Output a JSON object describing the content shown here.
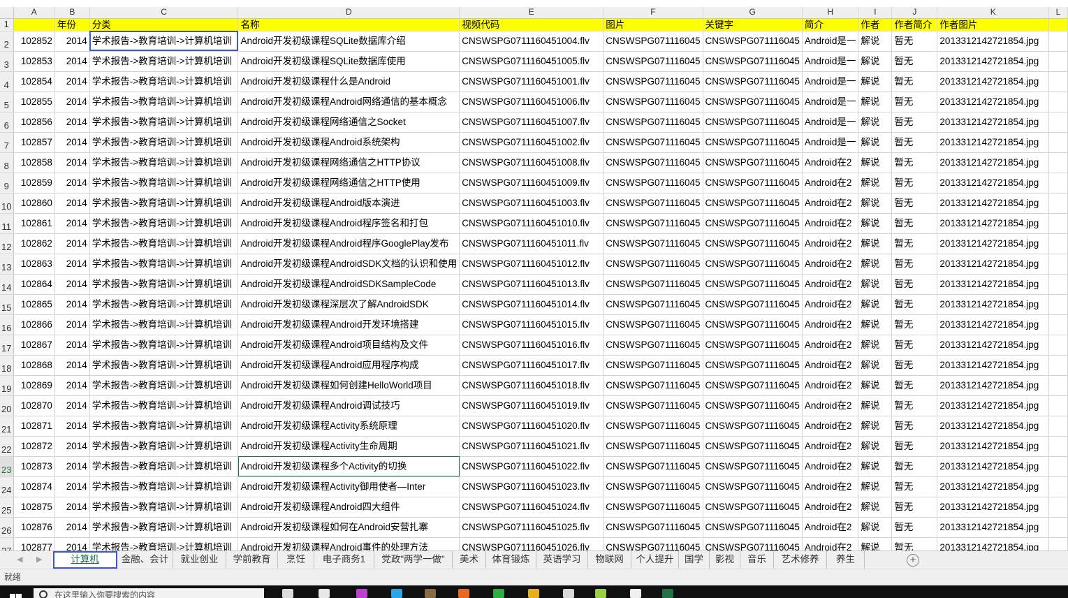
{
  "columns": [
    {
      "letter": "A",
      "width": 72
    },
    {
      "letter": "B",
      "width": 72
    },
    {
      "letter": "C",
      "width": 222
    },
    {
      "letter": "D",
      "width": 305
    },
    {
      "letter": "E",
      "width": 234
    },
    {
      "letter": "F",
      "width": 72
    },
    {
      "letter": "G",
      "width": 72
    },
    {
      "letter": "H",
      "width": 72
    },
    {
      "letter": "I",
      "width": 72
    },
    {
      "letter": "J",
      "width": 72
    },
    {
      "letter": "K",
      "width": 178
    },
    {
      "letter": "L",
      "width": 60
    }
  ],
  "headers": [
    "",
    "年份",
    "分类",
    "名称",
    "视频代码",
    "图片",
    "关键字",
    "简介",
    "作者",
    "作者简介",
    "作者图片",
    ""
  ],
  "common": {
    "year": "2014",
    "category": "学术报告->教育培训->计算机培训",
    "keyword": "CNSWSPG071116045",
    "author": "解说",
    "author_intro": "暂无",
    "author_image": "201331214272185​4.jpg"
  },
  "rows": [
    {
      "row_num": "2",
      "id": "102852",
      "name": "Android开发初级课程SQLite数据库介绍",
      "video": "CNSWSPG0711160451004.flv",
      "intro": "Android是一"
    },
    {
      "row_num": "3",
      "id": "102853",
      "name": "Android开发初级课程SQLite数据库使用",
      "video": "CNSWSPG0711160451005.flv",
      "intro": "Android是一"
    },
    {
      "row_num": "4",
      "id": "102854",
      "name": "Android开发初级课程什么是Android",
      "video": "CNSWSPG0711160451001.flv",
      "intro": "Android是一"
    },
    {
      "row_num": "5",
      "id": "102855",
      "name": "Android开发初级课程Android网络通信的基本概念",
      "video": "CNSWSPG0711160451006.flv",
      "intro": "Android是一"
    },
    {
      "row_num": "6",
      "id": "102856",
      "name": "Android开发初级课程网络通信之Socket",
      "video": "CNSWSPG0711160451007.flv",
      "intro": "Android是一"
    },
    {
      "row_num": "7",
      "id": "102857",
      "name": "Android开发初级课程Android系统架构",
      "video": "CNSWSPG0711160451002.flv",
      "intro": "Android是一"
    },
    {
      "row_num": "8",
      "id": "102858",
      "name": "Android开发初级课程网络通信之HTTP协议",
      "video": "CNSWSPG0711160451008.flv",
      "intro": "Android在2"
    },
    {
      "row_num": "9",
      "id": "102859",
      "name": "Android开发初级课程网络通信之HTTP使用",
      "video": "CNSWSPG0711160451009.flv",
      "intro": "Android在2"
    },
    {
      "row_num": "10",
      "id": "102860",
      "name": "Android开发初级课程Android版本演进",
      "video": "CNSWSPG0711160451003.flv",
      "intro": "Android在2"
    },
    {
      "row_num": "11",
      "id": "102861",
      "name": "Android开发初级课程Android程序签名和打包",
      "video": "CNSWSPG0711160451010.flv",
      "intro": "Android在2"
    },
    {
      "row_num": "12",
      "id": "102862",
      "name": "Android开发初级课程Android程序GooglePlay发布",
      "video": "CNSWSPG0711160451011.flv",
      "intro": "Android在2"
    },
    {
      "row_num": "13",
      "id": "102863",
      "name": "Android开发初级课程AndroidSDK文档的认识和使用",
      "video": "CNSWSPG0711160451012.flv",
      "intro": "Android在2"
    },
    {
      "row_num": "14",
      "id": "102864",
      "name": "Android开发初级课程AndroidSDKSampleCode",
      "video": "CNSWSPG0711160451013.flv",
      "intro": "Android在2"
    },
    {
      "row_num": "15",
      "id": "102865",
      "name": "Android开发初级课程深层次了解AndroidSDK",
      "video": "CNSWSPG0711160451014.flv",
      "intro": "Android在2"
    },
    {
      "row_num": "16",
      "id": "102866",
      "name": "Android开发初级课程Android开发环境搭建",
      "video": "CNSWSPG0711160451015.flv",
      "intro": "Android在2"
    },
    {
      "row_num": "17",
      "id": "102867",
      "name": "Android开发初级课程Android项目结构及文件",
      "video": "CNSWSPG0711160451016.flv",
      "intro": "Android在2"
    },
    {
      "row_num": "18",
      "id": "102868",
      "name": "Android开发初级课程Android应用程序构成",
      "video": "CNSWSPG0711160451017.flv",
      "intro": "Android在2"
    },
    {
      "row_num": "19",
      "id": "102869",
      "name": "Android开发初级课程如何创建HelloWorld项目",
      "video": "CNSWSPG0711160451018.flv",
      "intro": "Android在2"
    },
    {
      "row_num": "20",
      "id": "102870",
      "name": "Android开发初级课程Android调试技巧",
      "video": "CNSWSPG0711160451019.flv",
      "intro": "Android在2"
    },
    {
      "row_num": "21",
      "id": "102871",
      "name": "Android开发初级课程Activity系统原理",
      "video": "CNSWSPG0711160451020.flv",
      "intro": "Android在2"
    },
    {
      "row_num": "22",
      "id": "102872",
      "name": "Android开发初级课程Activity生命周期",
      "video": "CNSWSPG0711160451021.flv",
      "intro": "Android在2"
    },
    {
      "row_num": "23",
      "id": "102873",
      "name": "Android开发初级课程多个Activity的切换",
      "video": "CNSWSPG0711160451022.flv",
      "intro": "Android在2"
    },
    {
      "row_num": "24",
      "id": "102874",
      "name": "Android开发初级课程Activity御用使者—Inter",
      "video": "CNSWSPG0711160451023.flv",
      "intro": "Android在2"
    },
    {
      "row_num": "25",
      "id": "102875",
      "name": "Android开发初级课程Android四大组件",
      "video": "CNSWSPG0711160451024.flv",
      "intro": "Android在2"
    },
    {
      "row_num": "26",
      "id": "102876",
      "name": "Android开发初级课程如何在Android安营扎寨",
      "video": "CNSWSPG0711160451025.flv",
      "intro": "Android在2"
    },
    {
      "row_num": "27",
      "id": "102877",
      "name": "Android开发初级课程Android事件的处理方法",
      "video": "CNSWSPG0711160451026.flv",
      "intro": "Android在2"
    }
  ],
  "sheets": [
    {
      "label": "计算机",
      "active": true
    },
    {
      "label": "金融、会计",
      "active": false
    },
    {
      "label": "就业创业",
      "active": false
    },
    {
      "label": "学前教育",
      "active": false
    },
    {
      "label": "烹饪",
      "active": false
    },
    {
      "label": "电子商务1",
      "active": false
    },
    {
      "label": "党政\"两学一做\"",
      "active": false
    },
    {
      "label": "美术",
      "active": false
    },
    {
      "label": "体育锻炼",
      "active": false
    },
    {
      "label": "英语学习",
      "active": false
    },
    {
      "label": "物联网",
      "active": false
    },
    {
      "label": "个人提升",
      "active": false
    },
    {
      "label": "国学",
      "active": false
    },
    {
      "label": "影视",
      "active": false
    },
    {
      "label": "音乐",
      "active": false
    },
    {
      "label": "艺术修养",
      "active": false
    },
    {
      "label": "养生",
      "active": false
    }
  ],
  "status": {
    "ready": "就绪"
  },
  "taskbar": {
    "search_placeholder": "在这里输入你要搜索的内容"
  },
  "colors": {
    "header_fill": "#ffff00",
    "excel_green": "#217346",
    "selection_blue": "#3e5ac0"
  },
  "icons": {
    "add_sheet": "plus-circle-icon",
    "start": "windows-logo-icon",
    "search": "search-icon"
  }
}
